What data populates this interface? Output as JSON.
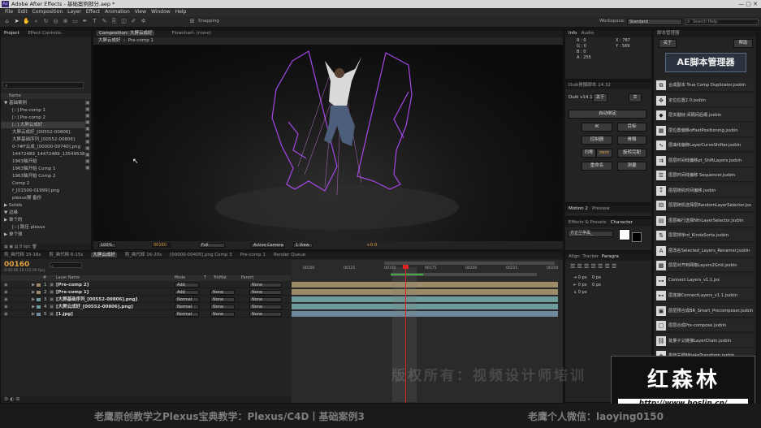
{
  "window": {
    "title": "Adobe After Effects - 基础案例部分.aep *",
    "logo": "Ae"
  },
  "menu": [
    "File",
    "Edit",
    "Composition",
    "Layer",
    "Effect",
    "Animation",
    "View",
    "Window",
    "Help"
  ],
  "toolbar": {
    "snapping": "Snapping",
    "workspace_label": "Workspace:",
    "workspace_value": "Standard",
    "search_placeholder": "Search Help"
  },
  "project": {
    "tabs": [
      "Project",
      "Effect Controls:"
    ],
    "name_col": "Name",
    "items": [
      "▼ 基础案例",
      "[::] Pre-comp 1",
      "[::] Pre-comp 2",
      "[::] 大屏云成好",
      "大屏云成好_[00552-00806].",
      "大屏基础序列_[00552-00806]",
      "0-7#F云成_[00000-00740].png",
      "14472489_14472489_13549538",
      "1963轴开始",
      "1963轴开始 Comp 1",
      "1963轴开始 Comp 2",
      "Comp 2",
      "f_[01500-01999].png",
      "plexus猴 备份",
      "▶ Solids",
      "▼ 边缘",
      "▶ 单个的",
      "[::] 路径 plexus",
      "▶ 单个球"
    ],
    "bpc": "8 bpc"
  },
  "composition": {
    "tab": "Composition: 大屏云成好",
    "flowchart": "Flowchart: (none)",
    "subtabs": [
      "大屏云成好",
      "Pre-comp 1"
    ],
    "zoom": "100%",
    "timecode": "00160",
    "resolution": "Full",
    "camera": "Active Camera",
    "views": "1 View",
    "exposure": "+0.0"
  },
  "info": {
    "tabs": [
      "Info",
      "Audio"
    ],
    "r": "R : 0",
    "g": "G : 0",
    "b": "B : 0",
    "a": "A : 255",
    "x": "X : 787",
    "y": "Y : 569"
  },
  "duik": {
    "tab": "Duik骨骼脚本 14.32",
    "version": "Duik v14.12",
    "about": "关于",
    "auto": "自动绑定",
    "buttons": [
      "IK",
      "目标",
      "控制器",
      "骨骼",
      "归零",
      "zero",
      "旋转完配",
      "重命名",
      "测量"
    ]
  },
  "motion": {
    "tabs": [
      "Motion 2",
      "Preview"
    ]
  },
  "effects": {
    "tabs": [
      "Effects & Presets",
      "Character"
    ],
    "font": "方正兰亭黑_"
  },
  "align": {
    "tabs": [
      "Align",
      "Tracker",
      "Paragra"
    ],
    "px": [
      "0 px",
      "0 px",
      "0 px",
      "0 px",
      "0 px"
    ]
  },
  "scripts": {
    "tab": "脚本管理器",
    "about": "关于",
    "help": "帮助",
    "banner": "AE脚本管理器",
    "items": [
      "合成副本 True Comp Duplicator.jsxbin",
      "定位位置2.0.jsxbin",
      "层关键帧 间隔间后缀.jsxbin",
      "层位置偏移offsetPositioning.jsxbin",
      "层曲线偏移LayerCurveShifter.jsxbin",
      "层层时间线偏移pt_ShiftLayers.jsxbin",
      "层层时间线偏移 Sequencer.jsxbin",
      "层层随机时间偏移.jsxbin",
      "层层随机选择层RandomLayerSelector.jsx",
      "层层每行选择NthLayerSelector.jsxbin",
      "层层排序rd_KindaSorta.jsxbin",
      "层改名Selected_Layers_Renamer.jsxbin",
      "层层对齐到网格Layers2Grid.jsxbin",
      "Connect Layers_v1.1.jsx",
      "层连接ConnectLayers_v1.1.jsxbin",
      "层层预合成BR_Smart_Precomposer.jsxbin",
      "层层合成Pre-compose.jsxbin",
      "批量子父链接LayerChain.jsxbin",
      "烘焙关键帧bakeTransform.jsxbin",
      "烘焙关键帧bakeTransform.jsx",
      "烘焙关键帧bakeTransform.jsxbin"
    ]
  },
  "timeline": {
    "tabs": [
      "剪_画代释 15-16s",
      "剪_画代释 6-15s",
      "大屏云成好",
      "剪_画代释 16-20s",
      "[00000-00405].png Comp 3",
      "Pre-comp 1",
      "Render Queue"
    ],
    "timecode": "00160",
    "subtime": "0:00:06:10 (25.00 fps)",
    "cols": [
      "#",
      "Layer Name",
      "Mode",
      "T",
      "TrkMat",
      "Parent"
    ],
    "layers": [
      {
        "num": "1",
        "name": "[Pre-comp 2]",
        "mode": "Add",
        "trk": "",
        "parent": "None",
        "color": "#9c8b68"
      },
      {
        "num": "2",
        "name": "[Pre-comp 1]",
        "mode": "Add",
        "trk": "None",
        "parent": "None",
        "color": "#9c8b68"
      },
      {
        "num": "3",
        "name": "[大屏基础序列_[00552-00806].png]",
        "mode": "Normal",
        "trk": "None",
        "parent": "None",
        "color": "#6e9c9c"
      },
      {
        "num": "4",
        "name": "[大屏云成好_[00552-00806].png]",
        "mode": "Normal",
        "trk": "None",
        "parent": "None",
        "color": "#6e9c9c"
      },
      {
        "num": "5",
        "name": "[1.jpg]",
        "mode": "Normal",
        "trk": "None",
        "parent": "None",
        "color": "#6e8a9c"
      }
    ],
    "ruler": [
      "00100",
      "00125",
      "00150",
      "00175",
      "00200",
      "00225",
      "00250"
    ]
  },
  "watermark": {
    "text": "版权所有：视频设计师培训",
    "logo_cn": "红森林",
    "url": "http://www.hoslin.cn/"
  },
  "caption": {
    "left": "老鹰原创教学之Plexus宝典教学：Plexus/C4D丨基础案例3",
    "right": "老鹰个人微信：laoying0150"
  }
}
